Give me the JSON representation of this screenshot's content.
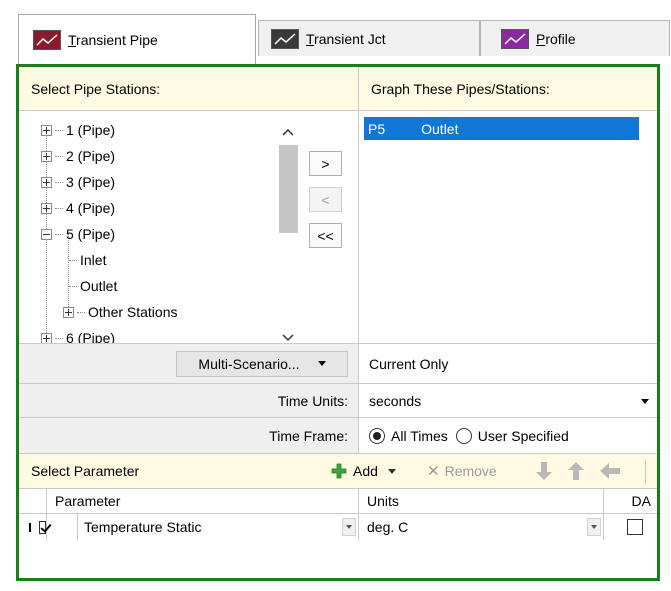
{
  "tabs": [
    {
      "label": "Transient Pipe",
      "accel": "T",
      "rest": "ransient Pipe",
      "active": true,
      "icon": "chart-line-icon",
      "icon_color": "#8b1a2a"
    },
    {
      "label": "Transient Jct",
      "accel": "T",
      "rest": "ransient Jct",
      "active": false,
      "icon": "chart-line-icon",
      "icon_color": "#3a3a3a"
    },
    {
      "label": "Profile",
      "accel": "P",
      "rest": "rofile",
      "active": false,
      "icon": "chart-line-icon",
      "icon_color": "#8b2aa0"
    }
  ],
  "stations": {
    "header": "Select Pipe Stations:",
    "tree": [
      {
        "label": "1 (Pipe)",
        "expanded": false
      },
      {
        "label": "2 (Pipe)",
        "expanded": false
      },
      {
        "label": "3 (Pipe)",
        "expanded": false
      },
      {
        "label": "4 (Pipe)",
        "expanded": false
      },
      {
        "label": "5 (Pipe)",
        "expanded": true,
        "children": [
          "Inlet",
          "Outlet",
          "Other Stations"
        ]
      },
      {
        "label": "6 (Pipe)",
        "expanded": false
      }
    ]
  },
  "transfer": {
    "add": ">",
    "remove": "<",
    "remove_all": "<<"
  },
  "graph": {
    "header": "Graph These Pipes/Stations:",
    "items": [
      {
        "pipe": "P5",
        "station": "Outlet",
        "selected": true
      }
    ]
  },
  "scenario": {
    "button": "Multi-Scenario...",
    "value": "Current Only"
  },
  "time_units": {
    "label": "Time Units:",
    "value": "seconds"
  },
  "time_frame": {
    "label": "Time Frame:",
    "options": [
      "All Times",
      "User Specified"
    ],
    "selected": "All Times"
  },
  "parameter_section": {
    "header": "Select Parameter",
    "add": "Add",
    "remove": "Remove"
  },
  "param_grid": {
    "columns": [
      "Parameter",
      "Units",
      "DA"
    ],
    "rows": [
      {
        "checked": true,
        "parameter": "Temperature Static",
        "units": "deg. C",
        "da": false
      }
    ]
  },
  "colors": {
    "frame": "#1c7d1c",
    "header_bg": "#fffbe3",
    "selection": "#0f78d7",
    "add_green": "#3aa53a"
  }
}
